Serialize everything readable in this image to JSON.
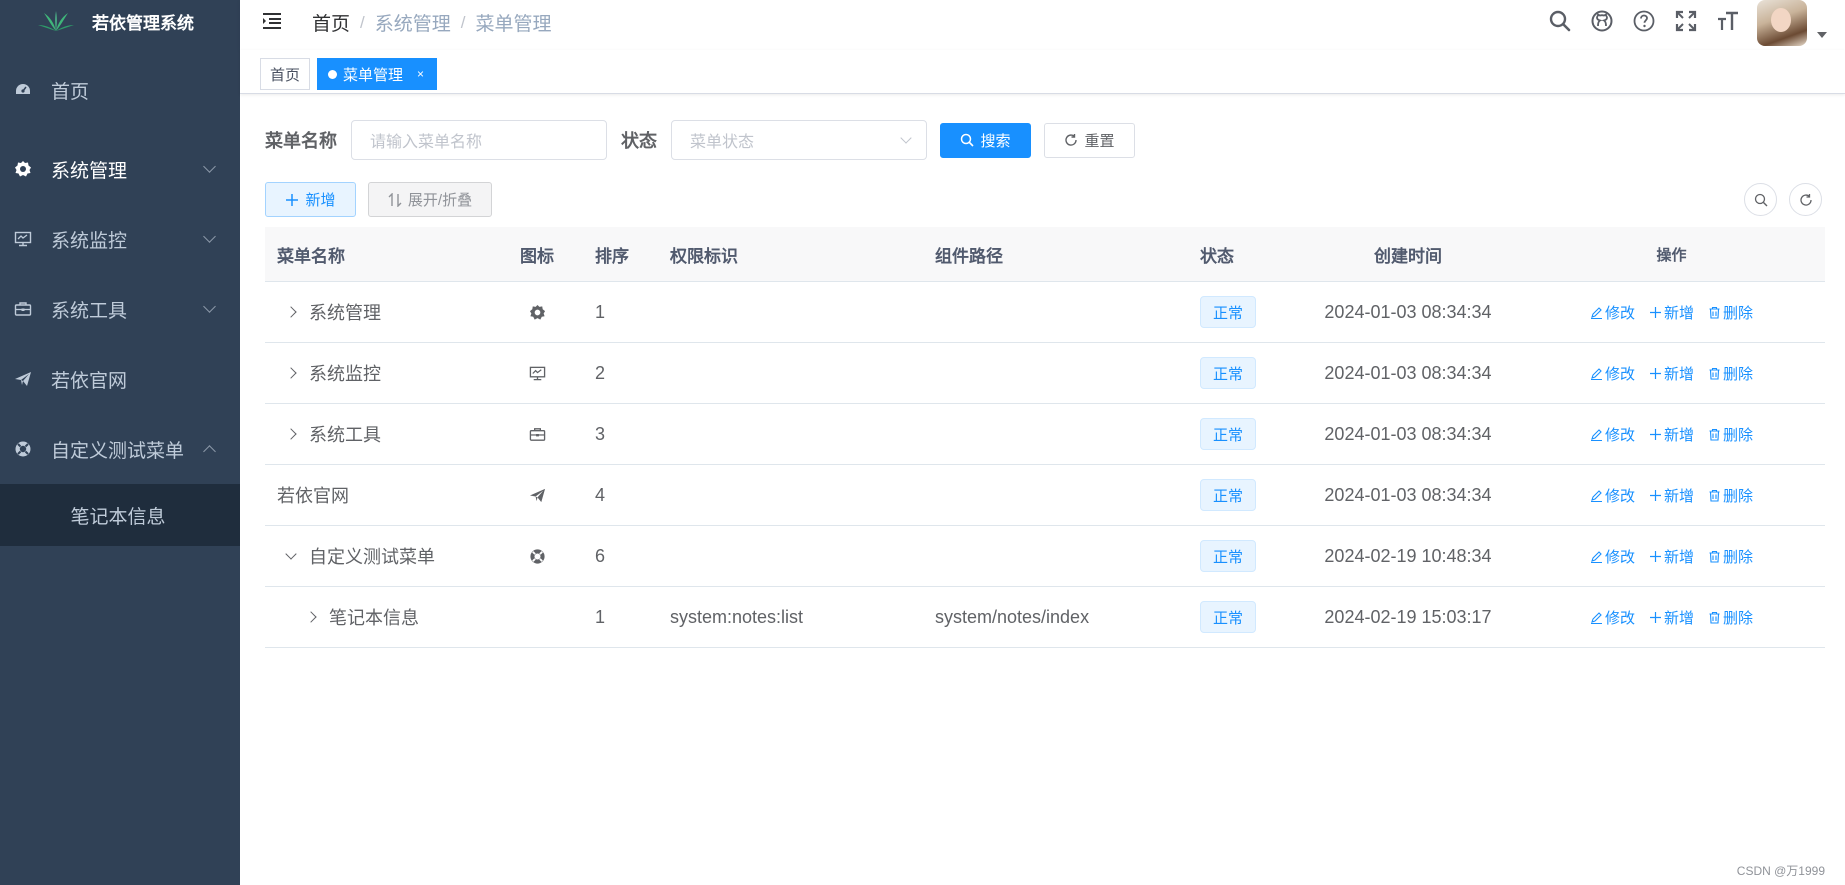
{
  "app": {
    "title": "若依管理系统"
  },
  "sidebar": {
    "items": [
      {
        "label": "首页",
        "icon": "dashboard-icon"
      },
      {
        "label": "系统管理",
        "icon": "gear-icon"
      },
      {
        "label": "系统监控",
        "icon": "monitor-icon"
      },
      {
        "label": "系统工具",
        "icon": "toolbox-icon"
      },
      {
        "label": "若依官网",
        "icon": "paper-plane-icon"
      },
      {
        "label": "自定义测试菜单",
        "icon": "lifebuoy-icon"
      }
    ],
    "subitem": {
      "label": "笔记本信息"
    }
  },
  "header": {
    "breadcrumb": [
      "首页",
      "系统管理",
      "菜单管理"
    ],
    "breadcrumb_sep": "/"
  },
  "tags": {
    "home": "首页",
    "active": "菜单管理",
    "close": "×"
  },
  "search": {
    "name_label": "菜单名称",
    "name_placeholder": "请输入菜单名称",
    "status_label": "状态",
    "status_placeholder": "菜单状态",
    "search_button": "搜索",
    "reset_button": "重置"
  },
  "toolbar": {
    "add_label": "新增",
    "expand_label": "展开/折叠"
  },
  "table": {
    "columns": [
      "菜单名称",
      "图标",
      "排序",
      "权限标识",
      "组件路径",
      "状态",
      "创建时间",
      "操作"
    ],
    "rows": [
      {
        "name": "系统管理",
        "sort": "1",
        "perm": "",
        "component": "",
        "status": "正常",
        "time": "2024-01-03 08:34:34"
      },
      {
        "name": "系统监控",
        "sort": "2",
        "perm": "",
        "component": "",
        "status": "正常",
        "time": "2024-01-03 08:34:34"
      },
      {
        "name": "系统工具",
        "sort": "3",
        "perm": "",
        "component": "",
        "status": "正常",
        "time": "2024-01-03 08:34:34"
      },
      {
        "name": "若依官网",
        "sort": "4",
        "perm": "",
        "component": "",
        "status": "正常",
        "time": "2024-01-03 08:34:34"
      },
      {
        "name": "自定义测试菜单",
        "sort": "6",
        "perm": "",
        "component": "",
        "status": "正常",
        "time": "2024-02-19 10:48:34"
      },
      {
        "name": "笔记本信息",
        "sort": "1",
        "perm": "system:notes:list",
        "component": "system/notes/index",
        "status": "正常",
        "time": "2024-02-19 15:03:17"
      }
    ],
    "ops": {
      "edit": "修改",
      "add": "新增",
      "delete": "删除"
    }
  },
  "watermark": "CSDN @万1999",
  "colors": {
    "sidebar_bg": "#304156",
    "submenu_bg": "#1f2d3d",
    "primary": "#1890ff"
  }
}
